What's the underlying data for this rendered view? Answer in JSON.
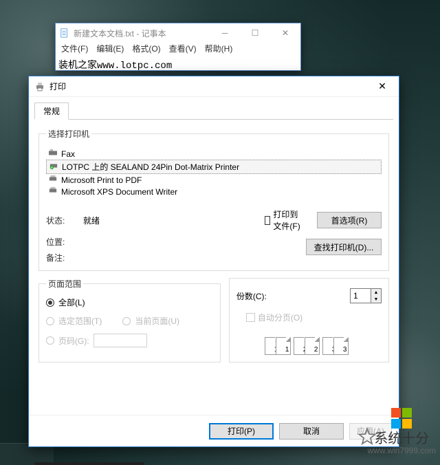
{
  "notepad": {
    "title": "新建文本文档.txt - 记事本",
    "menu": {
      "file": "文件(F)",
      "edit": "编辑(E)",
      "format": "格式(O)",
      "view": "查看(V)",
      "help": "帮助(H)"
    },
    "content": "装机之家www.lotpc.com"
  },
  "print": {
    "title": "打印",
    "tab_general": "常规",
    "group_printer": "选择打印机",
    "printers": [
      {
        "name": "Fax",
        "selected": false
      },
      {
        "name": "LOTPC 上的 SEALAND 24Pin Dot-Matrix Printer",
        "selected": true
      },
      {
        "name": "Microsoft Print to PDF",
        "selected": false
      },
      {
        "name": "Microsoft XPS Document Writer",
        "selected": false
      }
    ],
    "status_label": "状态:",
    "status_value": "就绪",
    "location_label": "位置:",
    "comment_label": "备注:",
    "print_to_file": "打印到文件(F)",
    "preferences_btn": "首选项(R)",
    "find_printer_btn": "查找打印机(D)...",
    "group_range": "页面范围",
    "range_all": "全部(L)",
    "range_selection": "选定范围(T)",
    "range_current": "当前页面(U)",
    "range_pages": "页码(G):",
    "copies_label": "份数(C):",
    "copies_value": "1",
    "collate": "自动分页(O)",
    "collate_seq": [
      "1",
      "1",
      "2",
      "2",
      "3",
      "3"
    ],
    "btn_print": "打印(P)",
    "btn_cancel": "取消",
    "btn_apply": "应用(A)"
  },
  "watermark": {
    "brand": "系统十分",
    "url": "www.win7999.com"
  }
}
